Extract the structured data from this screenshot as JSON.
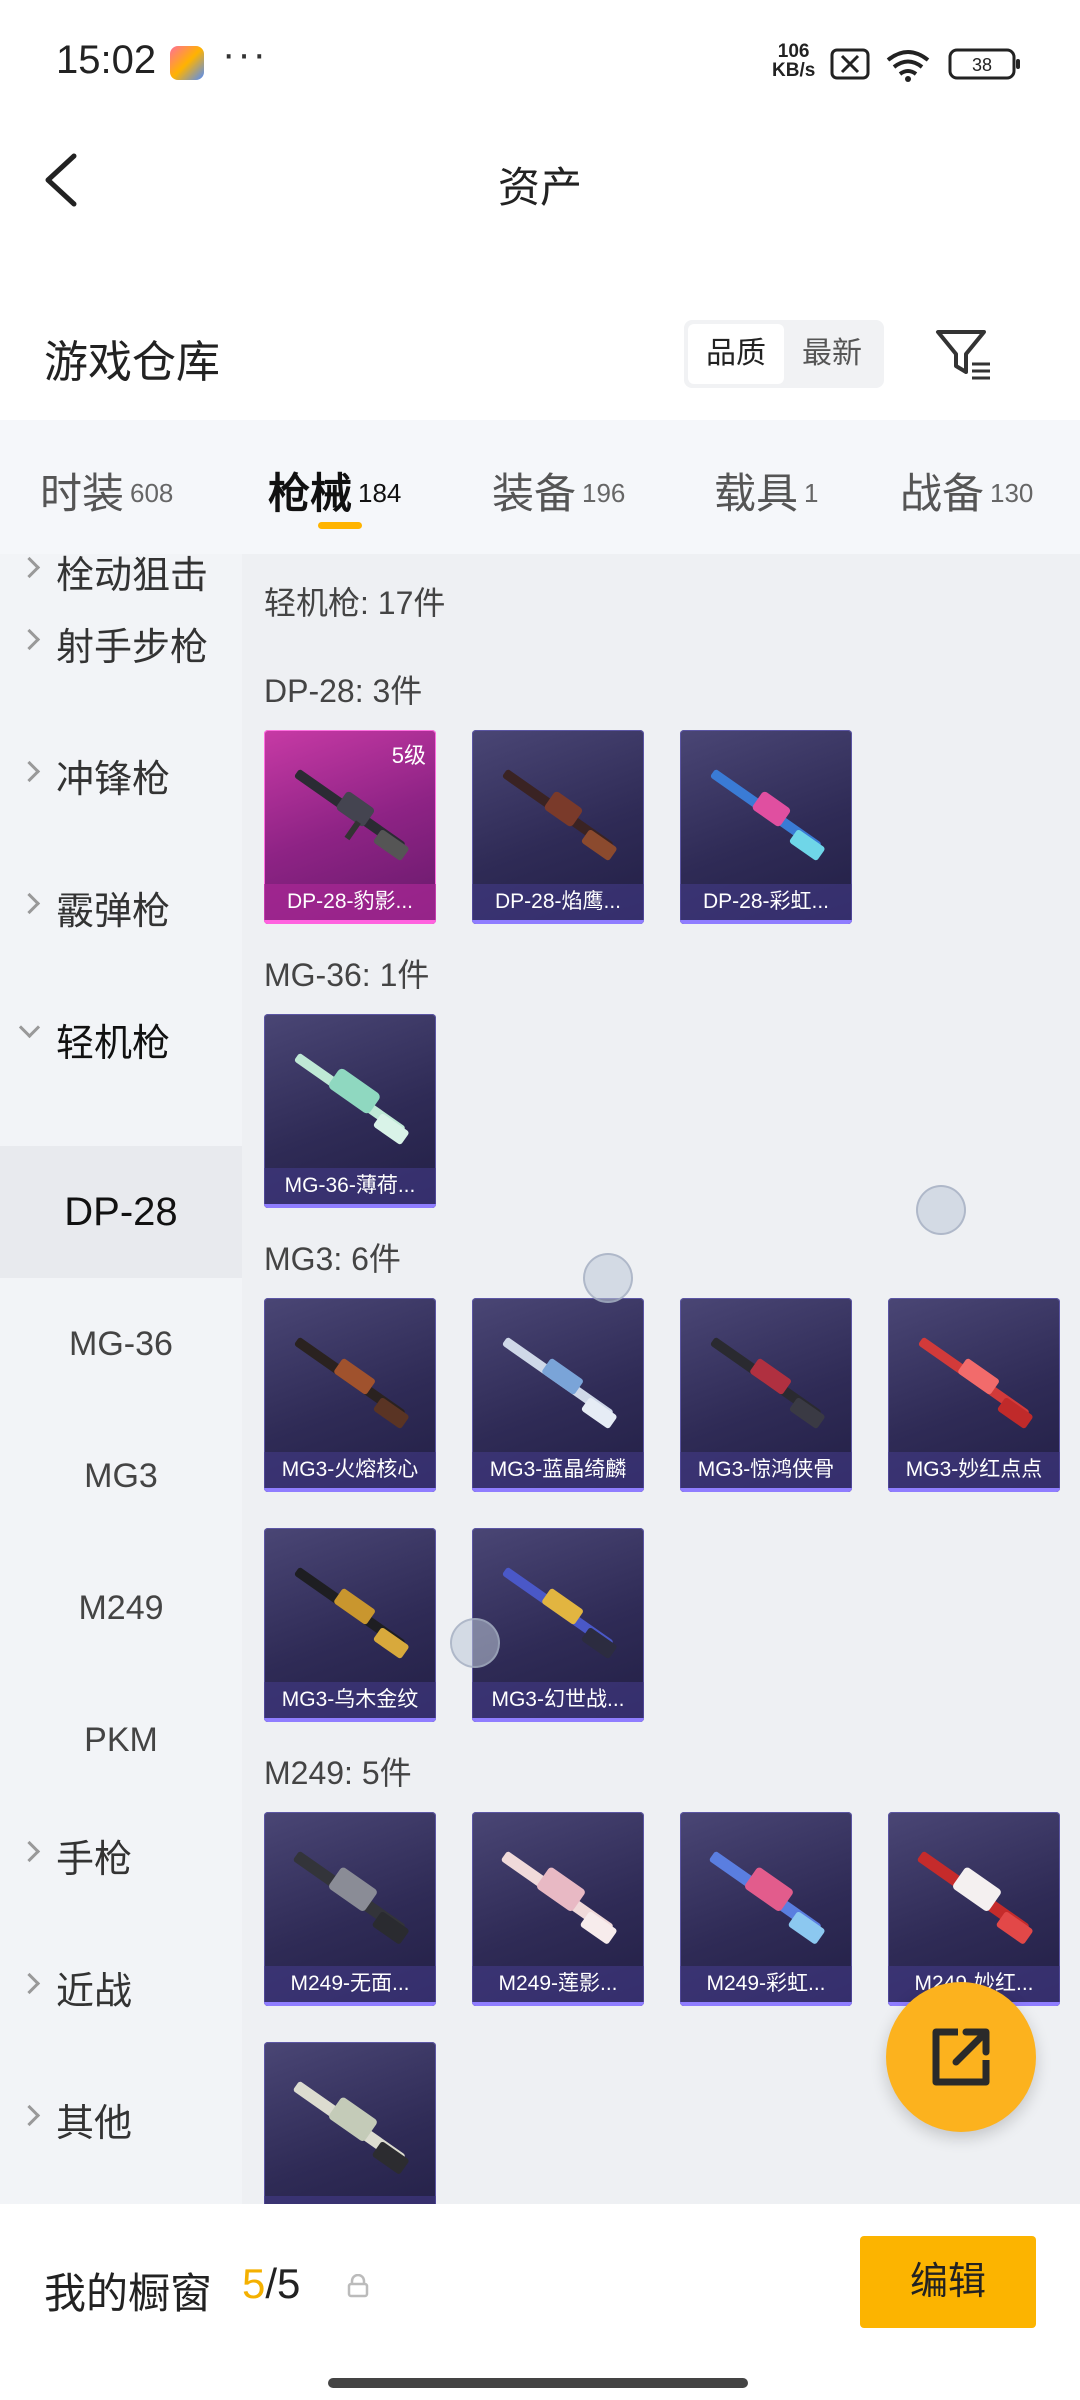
{
  "status_bar": {
    "time": "15:02",
    "dots": "···",
    "net_speed_value": "106",
    "net_speed_unit": "KB/s",
    "battery": "38"
  },
  "header": {
    "title": "资产"
  },
  "warehouse": {
    "title": "游戏仓库",
    "sort_options": [
      "品质",
      "最新"
    ],
    "active_sort": "品质"
  },
  "tabs": [
    {
      "label": "时装",
      "count": "608"
    },
    {
      "label": "枪械",
      "count": "184"
    },
    {
      "label": "装备",
      "count": "196"
    },
    {
      "label": "载具",
      "count": "1"
    },
    {
      "label": "战备",
      "count": "130"
    }
  ],
  "sidebar": {
    "cut_item": "栓动狙击",
    "items": [
      {
        "label": "射手步枪"
      },
      {
        "label": "冲锋枪"
      },
      {
        "label": "霰弹枪"
      },
      {
        "label": "轻机枪"
      }
    ],
    "sub_items": [
      "DP-28",
      "MG-36",
      "MG3",
      "M249",
      "PKM"
    ],
    "active_sub": "DP-28",
    "more_items": [
      {
        "label": "手枪"
      },
      {
        "label": "近战"
      },
      {
        "label": "其他"
      }
    ]
  },
  "content": {
    "category_title": "轻机枪: 17件",
    "groups": [
      {
        "title": "DP-28: 3件",
        "items": [
          {
            "name": "DP-28-豹影...",
            "level": "5级",
            "style": "pink"
          },
          {
            "name": "DP-28-焰鹰..."
          },
          {
            "name": "DP-28-彩虹..."
          }
        ]
      },
      {
        "title": "MG-36: 1件",
        "items": [
          {
            "name": "MG-36-薄荷..."
          }
        ]
      },
      {
        "title": "MG3: 6件",
        "items": [
          {
            "name": "MG3-火熔核心"
          },
          {
            "name": "MG3-蓝晶绮麟"
          },
          {
            "name": "MG3-惊鸿侠骨"
          },
          {
            "name": "MG3-妙红点点"
          },
          {
            "name": "MG3-乌木金纹"
          },
          {
            "name": "MG3-幻世战..."
          }
        ]
      },
      {
        "title": "M249: 5件",
        "items": [
          {
            "name": "M249-无面..."
          },
          {
            "name": "M249-莲影..."
          },
          {
            "name": "M249-彩虹..."
          },
          {
            "name": "M249-妙红..."
          },
          {
            "name": ""
          }
        ]
      }
    ]
  },
  "bottom_bar": {
    "label": "我的橱窗",
    "current": "5",
    "total": "/5",
    "edit_label": "编辑"
  },
  "colors": {
    "accent": "#fcb400",
    "card_purple": "#2f2b56",
    "card_pink": "#8e2385"
  },
  "icons": [
    "back-arrow-icon",
    "filter-icon",
    "lock-icon",
    "share-icon",
    "chevron-right-icon",
    "chevron-down-icon"
  ]
}
